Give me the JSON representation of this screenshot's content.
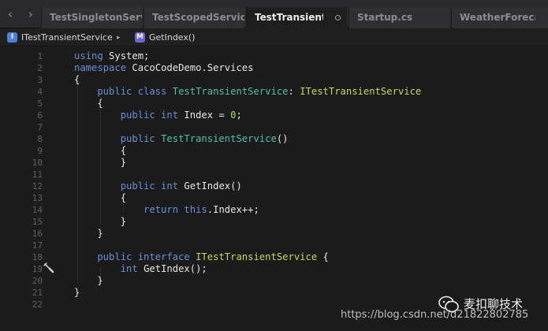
{
  "nav": {
    "back_icon": "chevron-left-icon",
    "forward_icon": "chevron-right-icon"
  },
  "tabs": [
    {
      "label": "TestSingletonServ",
      "active": false
    },
    {
      "label": "TestScopedService",
      "active": false
    },
    {
      "label": "TestTransientS",
      "active": true
    },
    {
      "label": "Startup.cs",
      "active": false
    },
    {
      "label": "WeatherForeca",
      "active": false
    }
  ],
  "breadcrumb": {
    "interface_badge": "I",
    "interface_name": "ITestTransientService",
    "separator": "▸",
    "method_badge": "M",
    "method_name": "GetIndex()"
  },
  "editor": {
    "line_numbers": [
      "1",
      "2",
      "3",
      "4",
      "5",
      "6",
      "7",
      "8",
      "9",
      "10",
      "11",
      "12",
      "13",
      "14",
      "15",
      "16",
      "17",
      "18",
      "19",
      "20",
      "21",
      "22"
    ],
    "lines": [
      [
        {
          "t": "using",
          "c": "kw"
        },
        {
          "t": " System;",
          "c": ""
        }
      ],
      [
        {
          "t": "namespace",
          "c": "kw"
        },
        {
          "t": " CacoCodeDemo.Services",
          "c": ""
        }
      ],
      [
        {
          "t": "{",
          "c": ""
        }
      ],
      [
        {
          "t": "    public class ",
          "c": "kw"
        },
        {
          "t": "TestTransientService",
          "c": "ty"
        },
        {
          "t": ": ",
          "c": ""
        },
        {
          "t": "ITestTransientService",
          "c": "itf"
        }
      ],
      [
        {
          "t": "    {",
          "c": ""
        }
      ],
      [
        {
          "t": "        public int ",
          "c": "kw"
        },
        {
          "t": "Index = ",
          "c": ""
        },
        {
          "t": "0",
          "c": "num"
        },
        {
          "t": ";",
          "c": ""
        }
      ],
      [],
      [
        {
          "t": "        public ",
          "c": "kw"
        },
        {
          "t": "TestTransientService",
          "c": "ty"
        },
        {
          "t": "()",
          "c": ""
        }
      ],
      [
        {
          "t": "        {",
          "c": ""
        }
      ],
      [
        {
          "t": "        }",
          "c": ""
        }
      ],
      [],
      [
        {
          "t": "        public int ",
          "c": "kw"
        },
        {
          "t": "GetIndex()",
          "c": ""
        }
      ],
      [
        {
          "t": "        {",
          "c": ""
        }
      ],
      [
        {
          "t": "            return this",
          "c": "kw"
        },
        {
          "t": ".Index++;",
          "c": ""
        }
      ],
      [
        {
          "t": "        }",
          "c": ""
        }
      ],
      [
        {
          "t": "    }",
          "c": ""
        }
      ],
      [],
      [
        {
          "t": "    public interface ",
          "c": "kw"
        },
        {
          "t": "ITestTransientService",
          "c": "itf"
        },
        {
          "t": " {",
          "c": ""
        }
      ],
      [
        {
          "t": "        int ",
          "c": "kw"
        },
        {
          "t": "GetIndex();",
          "c": ""
        }
      ],
      [
        {
          "t": "    }",
          "c": ""
        }
      ],
      [
        {
          "t": "}",
          "c": ""
        }
      ],
      []
    ]
  },
  "watermark": {
    "brand": "麦扣聊技术",
    "url": "https://blog.csdn.net/d21822802785"
  }
}
